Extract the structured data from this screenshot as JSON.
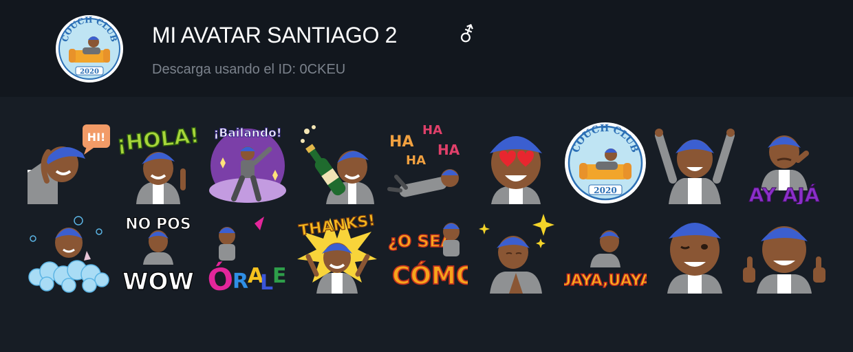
{
  "pack": {
    "title": "MI AVATAR SANTIAGO 2",
    "gender_icon": "male-female-symbol",
    "gender_glyph": "⚦",
    "download_text": "Descarga usando el ID: 0CKEU",
    "logo": {
      "name": "couch-club-logo",
      "text_top": "COUCH CLUB",
      "text_bottom": "2020"
    }
  },
  "colors": {
    "background": "#171d25",
    "header": "#12171e",
    "title": "#ffffff",
    "subtitle": "#7b828c",
    "cap": "#3b5fd0",
    "skin": "#8a5634",
    "shirt": "#8f9193"
  },
  "stickers": [
    {
      "name": "sticker-hi",
      "caption": "HI!"
    },
    {
      "name": "sticker-hola",
      "caption": "¡HOLA!"
    },
    {
      "name": "sticker-bailando",
      "caption": "¡Bailando!"
    },
    {
      "name": "sticker-champagne",
      "caption": ""
    },
    {
      "name": "sticker-hahaha",
      "caption": "HA HA HA HA"
    },
    {
      "name": "sticker-heart-eyes",
      "caption": ""
    },
    {
      "name": "sticker-couch-club",
      "caption_top": "COUCH CLUB",
      "caption_bottom": "2020"
    },
    {
      "name": "sticker-celebrate",
      "caption": ""
    },
    {
      "name": "sticker-ay-aja",
      "caption": "AY AJÁ"
    },
    {
      "name": "sticker-bubble-bath",
      "caption": ""
    },
    {
      "name": "sticker-no-pos-wow",
      "caption_top": "NO POS",
      "caption_bottom": "WOW"
    },
    {
      "name": "sticker-orale",
      "caption": "ÓRALE"
    },
    {
      "name": "sticker-thanks",
      "caption": "THANKS!"
    },
    {
      "name": "sticker-o-sea-como",
      "caption_top": "¿O SEA,",
      "caption_bottom": "CÓMO?"
    },
    {
      "name": "sticker-namaste",
      "caption": ""
    },
    {
      "name": "sticker-uaya-uaya",
      "caption": "UAYA,UAYA"
    },
    {
      "name": "sticker-wink",
      "caption": ""
    },
    {
      "name": "sticker-thumbs-up",
      "caption": ""
    }
  ]
}
